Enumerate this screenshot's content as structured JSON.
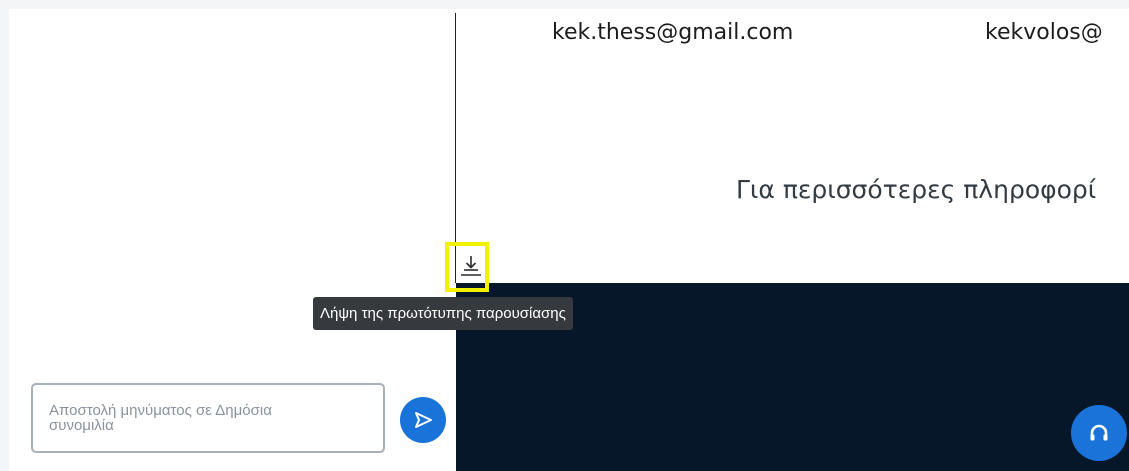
{
  "presentation": {
    "email_left": "kek.thess@gmail.com",
    "email_right": "kekvolos@",
    "info_text": "Για περισσότερες πληροφορί"
  },
  "download": {
    "icon": "download-icon",
    "tooltip": "Λήψη της πρωτότυπης παρουσίασης",
    "highlight_color": "#f2f200"
  },
  "chat": {
    "input_placeholder_line1": "Αποστολή μηνύματος σε Δημόσια",
    "input_placeholder_line2": "συνομιλία",
    "send_icon": "send-icon"
  },
  "audio": {
    "icon": "headphones-icon"
  },
  "colors": {
    "accent": "#1a73d9",
    "video_background": "#06172a",
    "tooltip_background": "#363a3e"
  }
}
